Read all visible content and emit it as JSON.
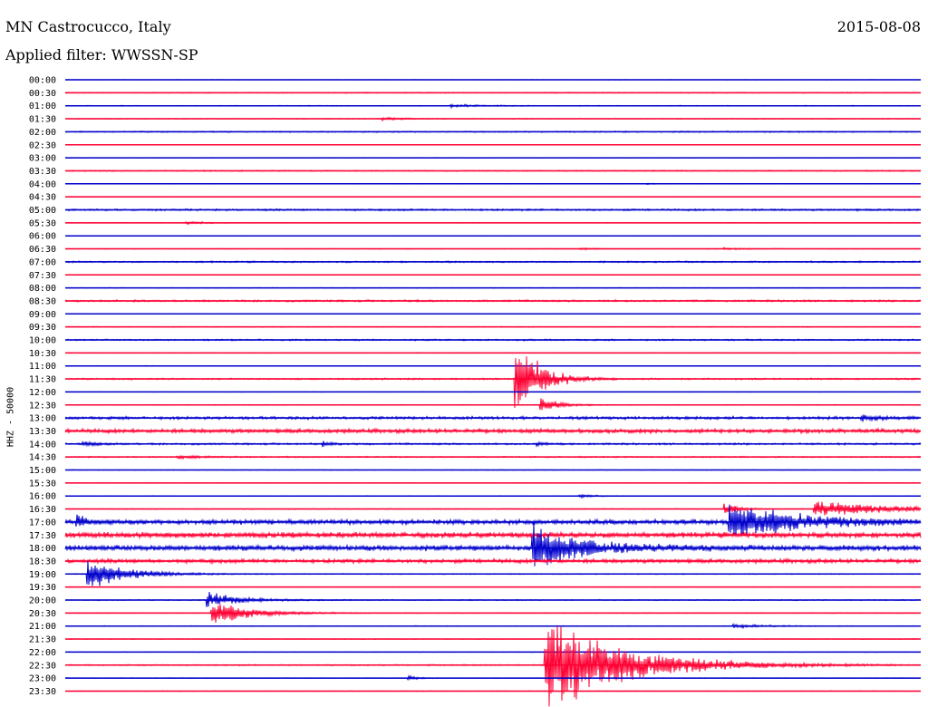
{
  "header": {
    "station": "MN Castrocucco, Italy",
    "date": "2015-08-08",
    "filter": "Applied filter: WWSSN-SP",
    "channel": "HHZ - 50000"
  },
  "chart_data": {
    "type": "line",
    "title": "MN Castrocucco, Italy",
    "subtitle": "Applied filter: WWSSN-SP",
    "ylabel": "HHZ - 50000",
    "colors": [
      "#0000cc",
      "#ff0033"
    ],
    "rows": [
      {
        "label": "00:00",
        "color": "#0000cc",
        "noise": 0.3,
        "events": []
      },
      {
        "label": "00:30",
        "color": "#ff0033",
        "noise": 0.6,
        "events": []
      },
      {
        "label": "01:00",
        "color": "#0000cc",
        "noise": 0.5,
        "events": [
          {
            "t": 0.45,
            "amp": 2,
            "dur": 0.05
          }
        ]
      },
      {
        "label": "01:30",
        "color": "#ff0033",
        "noise": 0.5,
        "events": [
          {
            "t": 0.37,
            "amp": 2,
            "dur": 0.04
          }
        ]
      },
      {
        "label": "02:00",
        "color": "#0000cc",
        "noise": 0.8,
        "events": []
      },
      {
        "label": "02:30",
        "color": "#ff0033",
        "noise": 0.3,
        "events": []
      },
      {
        "label": "03:00",
        "color": "#0000cc",
        "noise": 0.3,
        "events": []
      },
      {
        "label": "03:30",
        "color": "#ff0033",
        "noise": 0.7,
        "events": []
      },
      {
        "label": "04:00",
        "color": "#0000cc",
        "noise": 0.3,
        "events": [
          {
            "t": 0.68,
            "amp": 1.5,
            "dur": 0.01
          }
        ]
      },
      {
        "label": "04:30",
        "color": "#ff0033",
        "noise": 0.3,
        "events": []
      },
      {
        "label": "05:00",
        "color": "#0000cc",
        "noise": 1.2,
        "events": []
      },
      {
        "label": "05:30",
        "color": "#ff0033",
        "noise": 0.4,
        "events": [
          {
            "t": 0.14,
            "amp": 1.8,
            "dur": 0.04
          }
        ]
      },
      {
        "label": "06:00",
        "color": "#0000cc",
        "noise": 0.3,
        "events": []
      },
      {
        "label": "06:30",
        "color": "#ff0033",
        "noise": 0.4,
        "events": [
          {
            "t": 0.6,
            "amp": 1.5,
            "dur": 0.03
          },
          {
            "t": 0.77,
            "amp": 1.5,
            "dur": 0.03
          }
        ]
      },
      {
        "label": "07:00",
        "color": "#0000cc",
        "noise": 1.0,
        "events": []
      },
      {
        "label": "07:30",
        "color": "#ff0033",
        "noise": 0.4,
        "events": []
      },
      {
        "label": "08:00",
        "color": "#0000cc",
        "noise": 0.4,
        "events": []
      },
      {
        "label": "08:30",
        "color": "#ff0033",
        "noise": 1.2,
        "events": []
      },
      {
        "label": "09:00",
        "color": "#0000cc",
        "noise": 0.3,
        "events": []
      },
      {
        "label": "09:30",
        "color": "#ff0033",
        "noise": 0.5,
        "events": []
      },
      {
        "label": "10:00",
        "color": "#0000cc",
        "noise": 1.0,
        "events": []
      },
      {
        "label": "10:30",
        "color": "#ff0033",
        "noise": 0.4,
        "events": []
      },
      {
        "label": "11:00",
        "color": "#0000cc",
        "noise": 0.4,
        "events": []
      },
      {
        "label": "11:30",
        "color": "#ff0033",
        "noise": 1.0,
        "events": [
          {
            "t": 0.525,
            "amp": 60,
            "dur": 0.04
          }
        ]
      },
      {
        "label": "12:00",
        "color": "#0000cc",
        "noise": 0.3,
        "events": []
      },
      {
        "label": "12:30",
        "color": "#ff0033",
        "noise": 0.5,
        "events": [
          {
            "t": 0.555,
            "amp": 12,
            "dur": 0.03
          }
        ]
      },
      {
        "label": "13:00",
        "color": "#0000cc",
        "noise": 1.8,
        "events": [
          {
            "t": 0.93,
            "amp": 4,
            "dur": 0.04
          }
        ]
      },
      {
        "label": "13:30",
        "color": "#ff0033",
        "noise": 2.5,
        "events": []
      },
      {
        "label": "14:00",
        "color": "#0000cc",
        "noise": 1.2,
        "events": [
          {
            "t": 0.02,
            "amp": 3,
            "dur": 0.03
          },
          {
            "t": 0.3,
            "amp": 3,
            "dur": 0.02
          },
          {
            "t": 0.55,
            "amp": 3,
            "dur": 0.02
          }
        ]
      },
      {
        "label": "14:30",
        "color": "#ff0033",
        "noise": 0.8,
        "events": [
          {
            "t": 0.13,
            "amp": 2,
            "dur": 0.05
          }
        ]
      },
      {
        "label": "15:00",
        "color": "#0000cc",
        "noise": 0.4,
        "events": []
      },
      {
        "label": "15:30",
        "color": "#ff0033",
        "noise": 0.3,
        "events": []
      },
      {
        "label": "16:00",
        "color": "#0000cc",
        "noise": 0.4,
        "events": [
          {
            "t": 0.6,
            "amp": 2,
            "dur": 0.03
          }
        ]
      },
      {
        "label": "16:30",
        "color": "#ff0033",
        "noise": 0.5,
        "events": [
          {
            "t": 0.77,
            "amp": 10,
            "dur": 0.02
          },
          {
            "t": 0.875,
            "amp": 12,
            "dur": 0.12
          }
        ]
      },
      {
        "label": "17:00",
        "color": "#0000cc",
        "noise": 3.0,
        "events": [
          {
            "t": 0.012,
            "amp": 8,
            "dur": 0.02
          },
          {
            "t": 0.775,
            "amp": 24,
            "dur": 0.12
          }
        ]
      },
      {
        "label": "17:30",
        "color": "#ff0033",
        "noise": 3.5,
        "events": []
      },
      {
        "label": "18:00",
        "color": "#0000cc",
        "noise": 3.5,
        "events": [
          {
            "t": 0.545,
            "amp": 28,
            "dur": 0.09
          }
        ]
      },
      {
        "label": "18:30",
        "color": "#ff0033",
        "noise": 2.5,
        "events": []
      },
      {
        "label": "19:00",
        "color": "#0000cc",
        "noise": 0.6,
        "events": [
          {
            "t": 0.025,
            "amp": 20,
            "dur": 0.07
          }
        ]
      },
      {
        "label": "19:30",
        "color": "#ff0033",
        "noise": 0.4,
        "events": []
      },
      {
        "label": "20:00",
        "color": "#0000cc",
        "noise": 0.6,
        "events": [
          {
            "t": 0.165,
            "amp": 10,
            "dur": 0.06
          }
        ]
      },
      {
        "label": "20:30",
        "color": "#ff0033",
        "noise": 0.5,
        "events": [
          {
            "t": 0.17,
            "amp": 16,
            "dur": 0.07
          }
        ]
      },
      {
        "label": "21:00",
        "color": "#0000cc",
        "noise": 0.5,
        "events": [
          {
            "t": 0.78,
            "amp": 3,
            "dur": 0.05
          }
        ]
      },
      {
        "label": "21:30",
        "color": "#ff0033",
        "noise": 0.4,
        "events": []
      },
      {
        "label": "22:00",
        "color": "#0000cc",
        "noise": 0.4,
        "events": []
      },
      {
        "label": "22:30",
        "color": "#ff0033",
        "noise": 0.8,
        "events": [
          {
            "t": 0.56,
            "amp": 62,
            "dur": 0.14
          }
        ]
      },
      {
        "label": "23:00",
        "color": "#0000cc",
        "noise": 0.4,
        "events": [
          {
            "t": 0.4,
            "amp": 3,
            "dur": 0.02
          }
        ]
      },
      {
        "label": "23:30",
        "color": "#ff0033",
        "noise": 0.4,
        "events": []
      }
    ],
    "grid": false,
    "legend": "none"
  }
}
